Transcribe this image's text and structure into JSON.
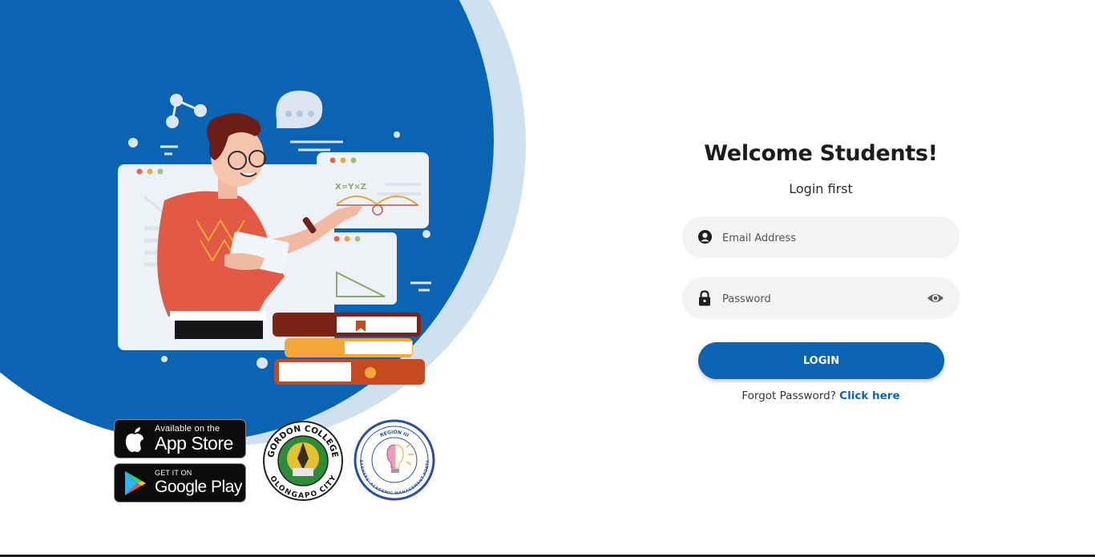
{
  "login": {
    "title": "Welcome Students!",
    "subtitle": "Login first",
    "email_placeholder": "Email Address",
    "password_placeholder": "Password",
    "login_button": "LOGIN",
    "forgot_text": "Forgot Password?",
    "forgot_link": "Click here"
  },
  "badges": {
    "app_store_small": "Available on the",
    "app_store_big": "App Store",
    "google_play_small": "GET IT ON",
    "google_play_big": "Google Play"
  },
  "seals": {
    "gordon_college": "GORDON COLLEGE",
    "gordon_city": "OLONGAPO CITY",
    "lamp_region": "REGION III",
    "lamp_name": "LEARNERS' ACADEMIC MANAGEMENT PORTAL"
  },
  "colors": {
    "primary_blue": "#0a63b3",
    "light_blue": "#cfe0ee",
    "field_bg": "#f3f3f3"
  },
  "icons": {
    "email": "user-circle-icon",
    "password": "lock-icon",
    "toggle": "eye-icon"
  }
}
